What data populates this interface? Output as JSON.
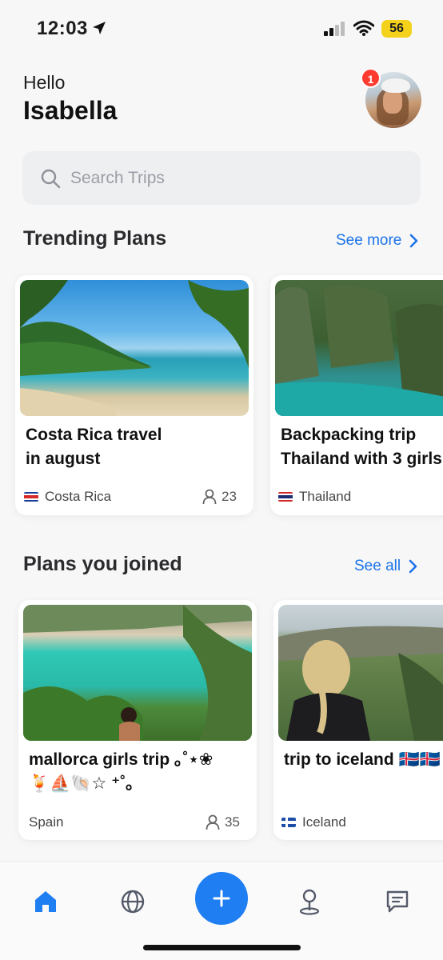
{
  "status_bar": {
    "time": "12:03",
    "battery": "56"
  },
  "header": {
    "greeting": "Hello",
    "user_name": "Isabella",
    "notification_count": "1"
  },
  "search": {
    "placeholder": "Search Trips",
    "value": ""
  },
  "trending": {
    "title": "Trending Plans",
    "link_label": "See more",
    "cards": [
      {
        "title_line1": "Costa Rica travel",
        "title_line2": "in august",
        "country": "Costa Rica",
        "members": "23"
      },
      {
        "title_line1": "Backpacking trip",
        "title_line2": "Thailand with 3 girls",
        "country": "Thailand"
      }
    ]
  },
  "joined": {
    "title": "Plans you joined",
    "link_label": "See all",
    "cards": [
      {
        "title_line1": "mallorca girls trip ｡˚⋆❀",
        "title_line2": "🍹⛵🐚☆ ⁺˚｡",
        "country": "Spain",
        "members": "35"
      },
      {
        "title_line1": "trip to iceland 🇮🇸🇮🇸",
        "country": "Iceland"
      }
    ]
  },
  "nav": {
    "items": [
      "home-icon",
      "globe-icon",
      "add-icon",
      "location-pin-icon",
      "chat-icon"
    ],
    "active": "home",
    "accent": "#1f7ef2"
  }
}
